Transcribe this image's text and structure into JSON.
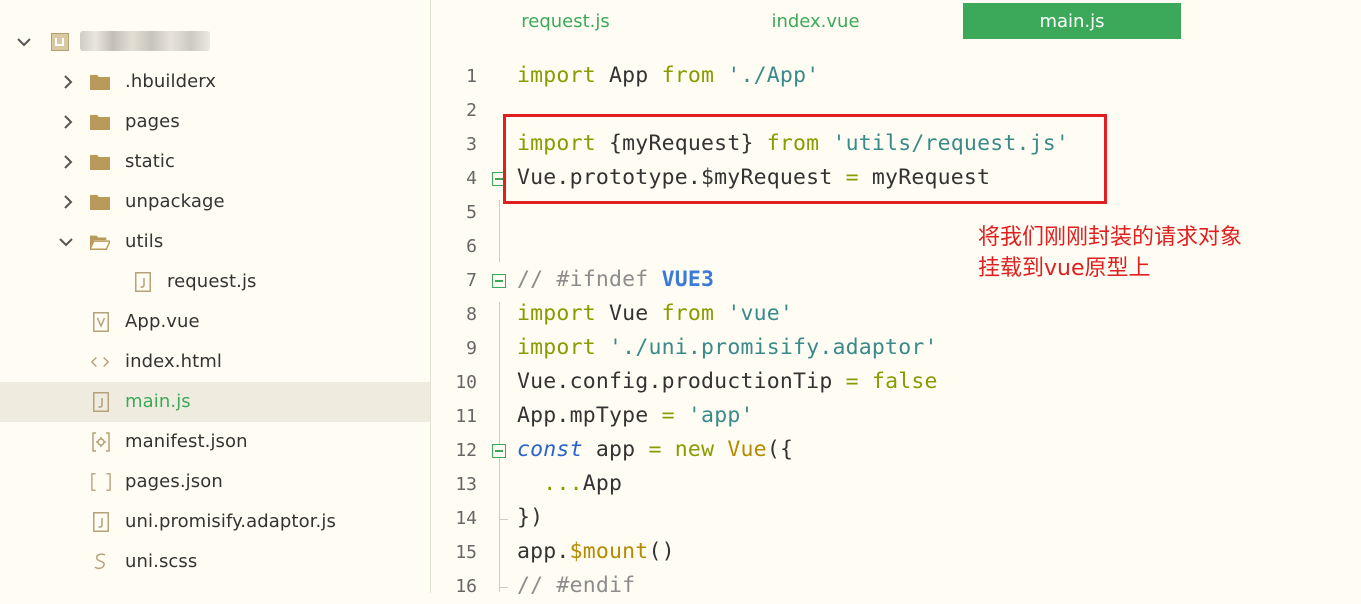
{
  "sidebar": {
    "items": [
      {
        "label": "",
        "type": "project",
        "expanded": true,
        "icon": "project-icon"
      },
      {
        "label": ".hbuilderx",
        "type": "folder",
        "expanded": false,
        "icon": "folder-icon"
      },
      {
        "label": "pages",
        "type": "folder",
        "expanded": false,
        "icon": "folder-icon"
      },
      {
        "label": "static",
        "type": "folder",
        "expanded": false,
        "icon": "folder-icon"
      },
      {
        "label": "unpackage",
        "type": "folder",
        "expanded": false,
        "icon": "folder-icon"
      },
      {
        "label": "utils",
        "type": "folder",
        "expanded": true,
        "icon": "folder-open-icon"
      },
      {
        "label": "request.js",
        "type": "file",
        "icon": "js-file-icon"
      },
      {
        "label": "App.vue",
        "type": "file",
        "icon": "vue-file-icon"
      },
      {
        "label": "index.html",
        "type": "file",
        "icon": "html-file-icon"
      },
      {
        "label": "main.js",
        "type": "file",
        "icon": "js-file-icon",
        "selected": true
      },
      {
        "label": "manifest.json",
        "type": "file",
        "icon": "manifest-file-icon"
      },
      {
        "label": "pages.json",
        "type": "file",
        "icon": "json-file-icon"
      },
      {
        "label": "uni.promisify.adaptor.js",
        "type": "file",
        "icon": "js-file-icon"
      },
      {
        "label": "uni.scss",
        "type": "file",
        "icon": "scss-file-icon"
      }
    ]
  },
  "tabs": [
    {
      "label": "request.js",
      "active": false
    },
    {
      "label": "index.vue",
      "active": false
    },
    {
      "label": "main.js",
      "active": true
    }
  ],
  "editor": {
    "lines": [
      {
        "num": "1"
      },
      {
        "num": "2"
      },
      {
        "num": "3"
      },
      {
        "num": "4"
      },
      {
        "num": "5"
      },
      {
        "num": "6"
      },
      {
        "num": "7"
      },
      {
        "num": "8"
      },
      {
        "num": "9"
      },
      {
        "num": "10"
      },
      {
        "num": "11"
      },
      {
        "num": "12"
      },
      {
        "num": "13"
      },
      {
        "num": "14"
      },
      {
        "num": "15"
      },
      {
        "num": "16"
      }
    ],
    "code": {
      "l1": [
        "import",
        " App ",
        "from",
        " ",
        "'./App'"
      ],
      "l3": [
        "import",
        " {myRequest} ",
        "from",
        " ",
        "'utils/request.js'"
      ],
      "l4": [
        "Vue.prototype.$myRequest ",
        "=",
        " myRequest"
      ],
      "l7": [
        "// #ifndef ",
        "VUE3"
      ],
      "l8": [
        "import",
        " Vue ",
        "from",
        " ",
        "'vue'"
      ],
      "l9": [
        "import",
        " ",
        "'./uni.promisify.adaptor'"
      ],
      "l10": [
        "Vue.config.productionTip ",
        "=",
        " ",
        "false"
      ],
      "l11": [
        "App.mpType ",
        "=",
        " ",
        "'app'"
      ],
      "l12": [
        "const",
        " app ",
        "=",
        " ",
        "new",
        " ",
        "Vue",
        "({"
      ],
      "l13": [
        "  ",
        "...",
        "App"
      ],
      "l14": [
        "})"
      ],
      "l15": [
        "app.",
        "$mount",
        "()"
      ],
      "l16": [
        "// #endif"
      ]
    }
  },
  "annotation": {
    "line1": "将我们刚刚封装的请求对象",
    "line2": "挂载到vue原型上",
    "color": "#e02020"
  },
  "colors": {
    "accent": "#3ca95a",
    "background": "#fffdf3",
    "selected_row": "#efecdf"
  }
}
